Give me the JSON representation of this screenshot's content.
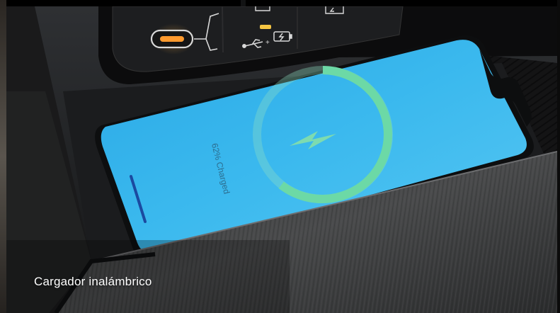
{
  "caption": "Cargador inalámbrico",
  "phone_screen": {
    "status_text": "62% Charged",
    "icon": "lightning-bolt-icon",
    "charge_level": 0.62
  },
  "console_icons": {
    "usb_c_port": "usb-c-port-icon",
    "usb_symbol": "usb-icon",
    "battery_charge": "battery-charge-icon"
  },
  "colors": {
    "screen_blue": "#3ab7ec",
    "ring_green": "#6cd9a6",
    "indicator_amber": "#f5c542",
    "caption_text": "#ffffff"
  }
}
